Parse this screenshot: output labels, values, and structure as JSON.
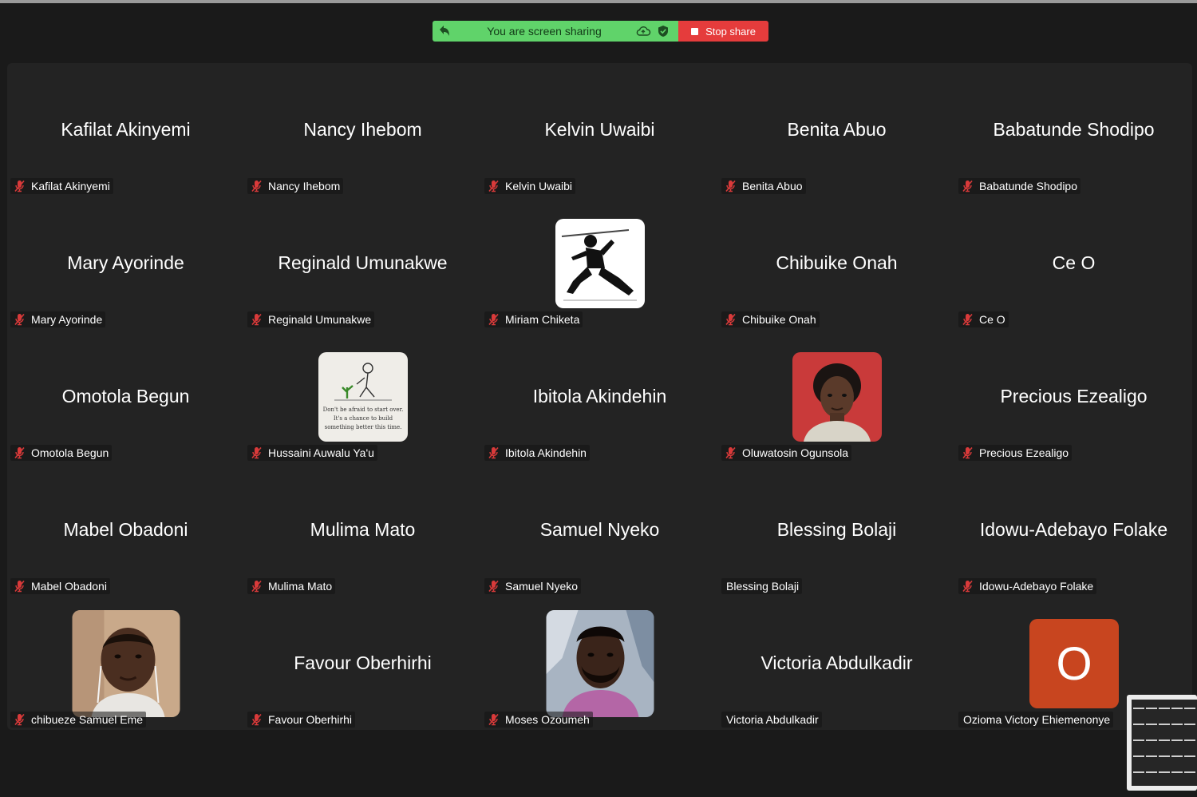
{
  "share_bar": {
    "status_text": "You are screen sharing",
    "stop_label": "Stop share",
    "colors": {
      "green": "#60d36a",
      "red": "#e53c3c"
    }
  },
  "participants": [
    {
      "display": "Kafilat Akinyemi",
      "label": "Kafilat Akinyemi",
      "muted": true
    },
    {
      "display": "Nancy Ihebom",
      "label": "Nancy Ihebom",
      "muted": true
    },
    {
      "display": "Kelvin Uwaibi",
      "label": "Kelvin Uwaibi",
      "muted": true
    },
    {
      "display": "Benita Abuo",
      "label": "Benita Abuo",
      "muted": true
    },
    {
      "display": "Babatunde Shodipo",
      "label": "Babatunde Shodipo",
      "muted": true
    },
    {
      "display": "Mary Ayorinde",
      "label": "Mary Ayorinde",
      "muted": true
    },
    {
      "display": "Reginald Umunakwe",
      "label": "Reginald Umunakwe",
      "muted": true
    },
    {
      "display": "",
      "label": "Miriam Chiketa",
      "muted": true,
      "avatar": "ninja-illustration"
    },
    {
      "display": "Chibuike Onah",
      "label": "Chibuike Onah",
      "muted": true
    },
    {
      "display": "Ce O",
      "label": "Ce O",
      "muted": true
    },
    {
      "display": "Omotola Begun",
      "label": "Omotola Begun",
      "muted": true
    },
    {
      "display": "",
      "label": "Hussaini Auwalu Ya'u",
      "muted": true,
      "avatar": "quote-sketch",
      "quote": [
        "Don't be afraid to start over.",
        "It's a chance to build",
        "something better this time."
      ]
    },
    {
      "display": "Ibitola Akindehin",
      "label": "Ibitola Akindehin",
      "muted": true
    },
    {
      "display": "",
      "label": "Oluwatosin Ogunsola",
      "muted": true,
      "avatar": "portrait-red"
    },
    {
      "display": "Precious Ezealigo",
      "label": "Precious Ezealigo",
      "muted": true
    },
    {
      "display": "Mabel Obadoni",
      "label": "Mabel Obadoni",
      "muted": true
    },
    {
      "display": "Mulima Mato",
      "label": "Mulima Mato",
      "muted": true
    },
    {
      "display": "Samuel Nyeko",
      "label": "Samuel Nyeko",
      "muted": true
    },
    {
      "display": "Blessing Bolaji",
      "label": "Blessing Bolaji",
      "muted": false
    },
    {
      "display": "Idowu-Adebayo Folake",
      "label": "Idowu-Adebayo Folake",
      "muted": true
    },
    {
      "display": "",
      "label": "chibueze Samuel Eme",
      "muted": true,
      "avatar": "portrait-earbuds"
    },
    {
      "display": "Favour Oberhirhi",
      "label": "Favour Oberhirhi",
      "muted": true
    },
    {
      "display": "",
      "label": "Moses Ozoumeh",
      "muted": true,
      "avatar": "portrait-beard"
    },
    {
      "display": "Victoria Abdulkadir",
      "label": "Victoria Abdulkadir",
      "muted": false
    },
    {
      "display": "",
      "label": "Ozioma Victory Ehiemenonye",
      "muted": false,
      "avatar": "initial-o",
      "initial": "O",
      "initial_color": "#c8451f"
    }
  ]
}
